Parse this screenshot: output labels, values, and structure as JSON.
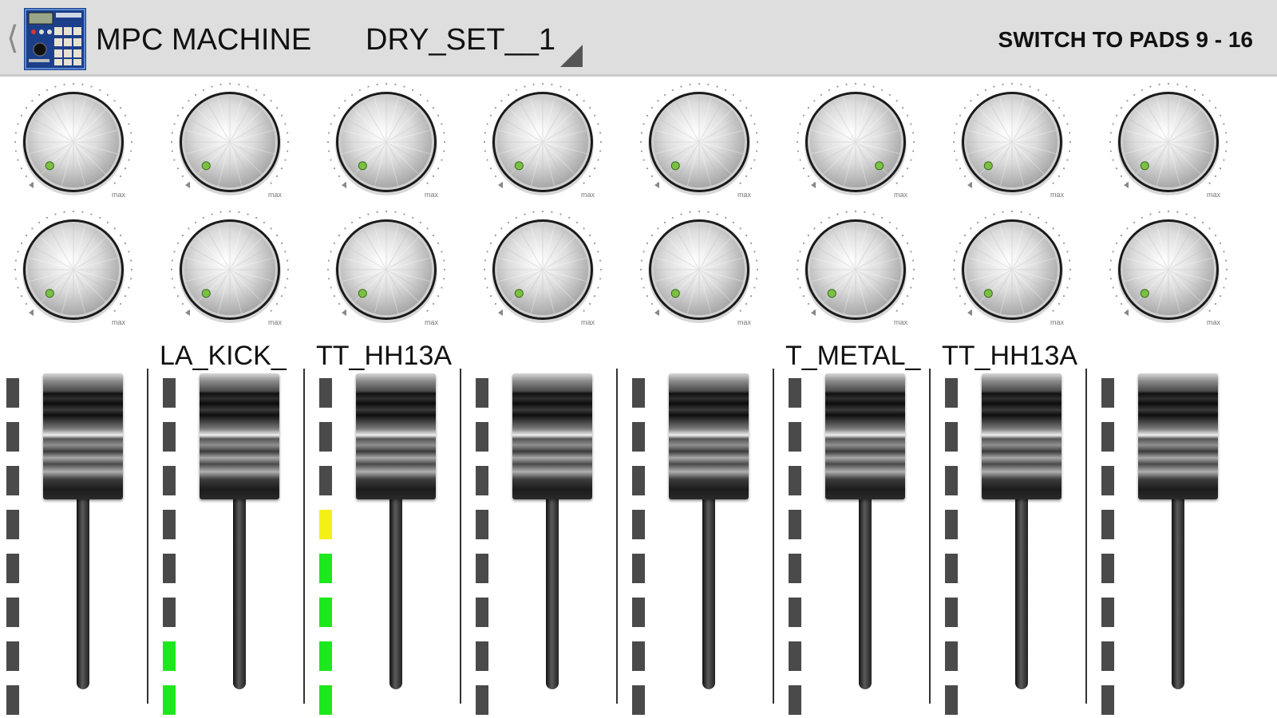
{
  "header": {
    "back_icon": "chevron-left-icon",
    "app_icon": "mpc-machine-app-icon",
    "app_title": "MPC MACHINE",
    "kit_name": "DRY_SET__1",
    "switch_label": "SWITCH TO PADS 9 - 16"
  },
  "knob_max_label": "max",
  "knob_rows": [
    {
      "row": "top",
      "levels": [
        0.0,
        0.0,
        0.0,
        0.0,
        0.0,
        1.0,
        0.0,
        0.0
      ]
    },
    {
      "row": "bottom",
      "levels": [
        0.0,
        0.0,
        0.0,
        0.0,
        0.0,
        0.0,
        0.0,
        0.0
      ]
    }
  ],
  "channels": [
    {
      "label": "",
      "fader_level": 1.0,
      "meter": [
        "off",
        "off",
        "off",
        "off",
        "off",
        "off",
        "off",
        "off"
      ]
    },
    {
      "label": "LA_KICK_",
      "fader_level": 1.0,
      "meter": [
        "off",
        "off",
        "off",
        "off",
        "off",
        "off",
        "green",
        "green"
      ]
    },
    {
      "label": "TT_HH13A",
      "fader_level": 1.0,
      "meter": [
        "off",
        "off",
        "off",
        "yellow",
        "green",
        "green",
        "green",
        "green"
      ]
    },
    {
      "label": "",
      "fader_level": 1.0,
      "meter": [
        "off",
        "off",
        "off",
        "off",
        "off",
        "off",
        "off",
        "off"
      ]
    },
    {
      "label": "",
      "fader_level": 1.0,
      "meter": [
        "off",
        "off",
        "off",
        "off",
        "off",
        "off",
        "off",
        "off"
      ]
    },
    {
      "label": "T_METAL_",
      "fader_level": 1.0,
      "meter": [
        "off",
        "off",
        "off",
        "off",
        "off",
        "off",
        "off",
        "off"
      ]
    },
    {
      "label": "TT_HH13A",
      "fader_level": 1.0,
      "meter": [
        "off",
        "off",
        "off",
        "off",
        "off",
        "off",
        "off",
        "off"
      ]
    },
    {
      "label": "",
      "fader_level": 1.0,
      "meter": [
        "off",
        "off",
        "off",
        "off",
        "off",
        "off",
        "off",
        "off"
      ]
    }
  ],
  "colors": {
    "led_off": "#4a4a4a",
    "led_green": "#1de81d",
    "led_yellow": "#f4f016",
    "knob_indicator": "#7bc043",
    "header_bg": "#dedede"
  }
}
